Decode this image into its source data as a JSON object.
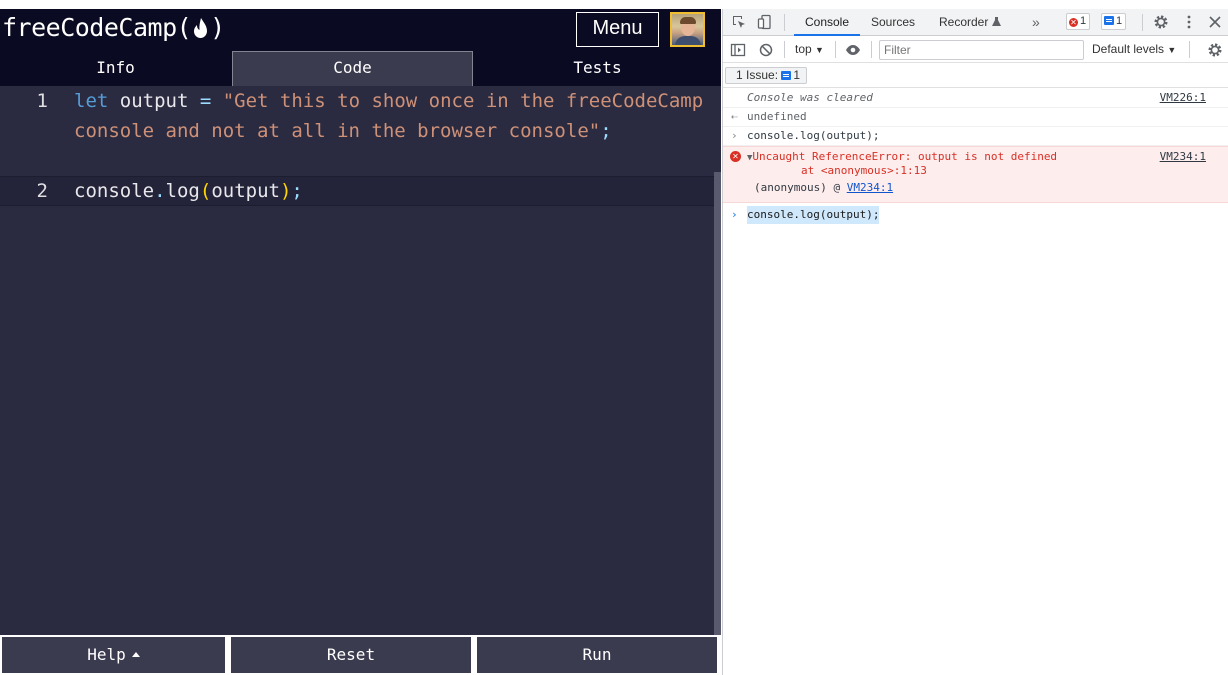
{
  "fcc": {
    "logo_text": "freeCodeCamp(",
    "logo_close": ")",
    "menu_label": "Menu",
    "tabs": [
      {
        "label": "Info"
      },
      {
        "label": "Code"
      },
      {
        "label": "Tests"
      }
    ],
    "editor": {
      "lines": [
        {
          "number": "1",
          "keyword": "let",
          "ident": " output ",
          "op": "=",
          "string": " \"Get this to show once in the freeCodeCamp console and not at all in the browser console\"",
          "end": ";"
        },
        {
          "number": "2",
          "obj": "console",
          "dot": ".",
          "method": "log",
          "open": "(",
          "arg": "output",
          "close": ")",
          "end": ";"
        }
      ]
    },
    "buttons": {
      "help": "Help",
      "reset": "Reset",
      "run": "Run"
    }
  },
  "devtools": {
    "tabs": [
      "Console",
      "Sources",
      "Recorder"
    ],
    "more": "»",
    "error_count": "1",
    "message_count": "1",
    "context": "top",
    "filter_placeholder": "Filter",
    "levels": "Default levels",
    "issues_label": "1 Issue:",
    "issues_count": "1",
    "console": {
      "cleared": "Console was cleared",
      "cleared_src": "VM226:1",
      "result": "undefined",
      "input1": "console.log(output);",
      "error_main": "Uncaught ReferenceError: output is not defined",
      "error_at": "at <anonymous>:1:13",
      "error_src": "VM234:1",
      "stack_fn": "(anonymous)",
      "stack_at": "@",
      "stack_link": "VM234:1",
      "prompt_input": "console.log(output);"
    }
  },
  "colors": {
    "fcc_nav": "#0a0a23",
    "editor_bg": "#2a2a40",
    "keyword": "#569cd6",
    "string": "#ce9178",
    "error": "#d93025",
    "accent": "#1a73e8"
  }
}
